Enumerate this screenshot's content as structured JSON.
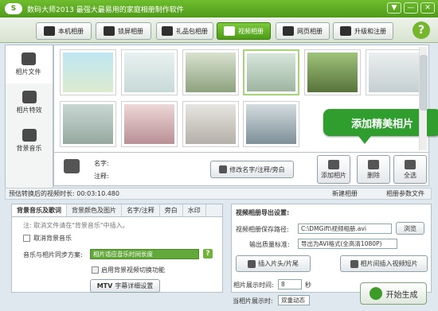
{
  "app": {
    "logo": "S",
    "title": "数码大师2013  最强大最易用的家庭相册制作软件",
    "window_buttons": [
      "▼",
      "—",
      "✕"
    ]
  },
  "tabs": [
    {
      "label": "本机相册",
      "icon": "computer-icon"
    },
    {
      "label": "锁屏相册",
      "icon": "monitor-icon"
    },
    {
      "label": "礼品包相册",
      "icon": "gift-icon"
    },
    {
      "label": "视频相册",
      "icon": "film-icon",
      "active": true
    },
    {
      "label": "网页相册",
      "icon": "webpage-icon"
    },
    {
      "label": "升级和注册",
      "icon": "upgrade-icon"
    }
  ],
  "help_label": "?",
  "sidebar": [
    {
      "label": "相片文件",
      "icon": "camera-icon",
      "active": true
    },
    {
      "label": "相片特效",
      "icon": "sparkle-icon"
    },
    {
      "label": "背景音乐",
      "icon": "music-note-icon"
    }
  ],
  "promo_text": "添加精美相片",
  "info": {
    "name_label": "名字:",
    "note_label": "注释:",
    "rename_button": "修改名字/注释/旁白"
  },
  "actions": {
    "add_label": "添加相片",
    "delete_label": "删除",
    "select_all_label": "全选"
  },
  "hintbar": {
    "text": "预估转换后的视频时长: 00:03:10.480",
    "new_album": "新建相册",
    "settings": "相册参数文件"
  },
  "left_panel": {
    "tabs": [
      "背景音乐及歌词",
      "背景颜色及图片",
      "名字/注释",
      "旁白",
      "水印"
    ],
    "note": "注: 取消文件请在\"背景音乐\"中插入。",
    "cancel_music": "取消背景音乐",
    "sync_label": "音乐与相片同步方案:",
    "sync_value": "相片适应音乐时间长度",
    "help": "?",
    "enable_transition": "启用背景视频切换功能",
    "mtv_label": "MTV",
    "mtv_button": "字幕详细设置"
  },
  "right_panel": {
    "title": "视频相册导出设置:",
    "path_label": "视频相册保存路径:",
    "path_value": "C:\\DMGift\\视频相册.avi",
    "browse": "浏览",
    "quality_label": "输出质量标准:",
    "quality_value": "导出为AVI格式(全高清1080P)",
    "insert_header": "插入片头/片尾",
    "insert_short": "相片间插入视频短片",
    "duration_label": "相片展示时间:",
    "duration_value": "8",
    "duration_unit": "秒",
    "effect_label": "当相片展示时:",
    "effect_value": "双重动态"
  },
  "start_button": "开始生成"
}
